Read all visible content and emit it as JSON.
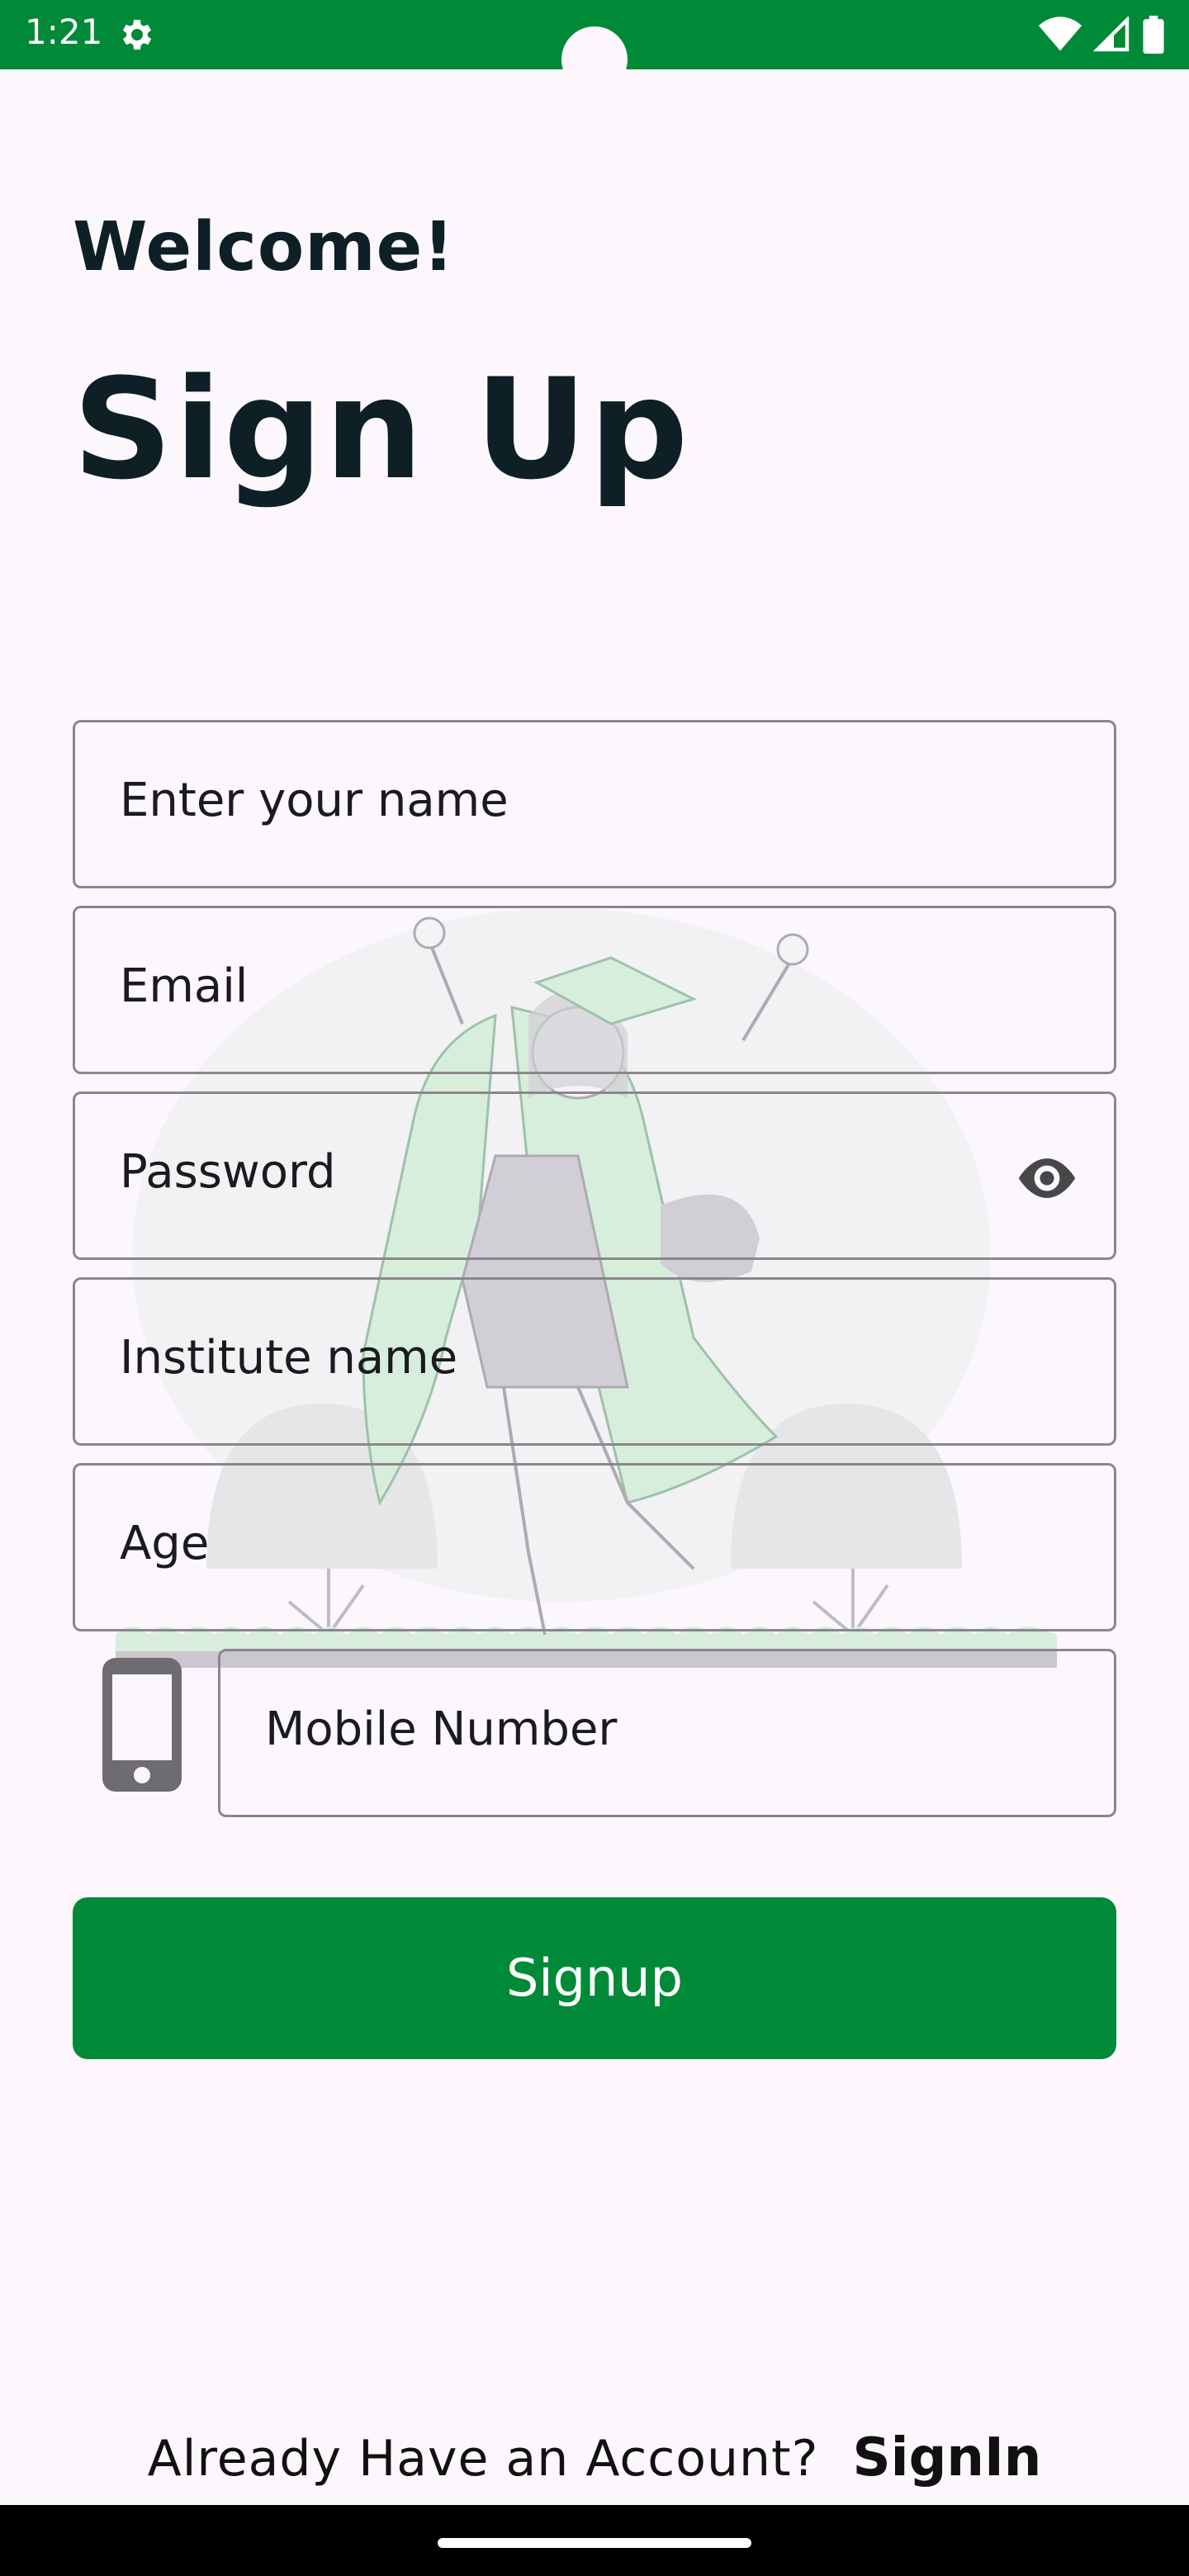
{
  "status_bar": {
    "time": "1:21",
    "icons": [
      "gear-icon",
      "wifi-icon",
      "signal-icon",
      "battery-icon"
    ],
    "color": "#008937"
  },
  "header": {
    "welcome": "Welcome!",
    "title": "Sign Up"
  },
  "form": {
    "name_placeholder": "Enter your name",
    "email_placeholder": "Email",
    "password_placeholder": "Password",
    "institute_placeholder": "Institute name",
    "age_placeholder": "Age",
    "mobile_placeholder": "Mobile Number",
    "submit_label": "Signup"
  },
  "footer": {
    "question": "Already Have an Account?",
    "signin_label": "SignIn"
  },
  "theme": {
    "accent": "#008937",
    "background": "#FCF7FC",
    "text_dark": "#0E1F26"
  }
}
